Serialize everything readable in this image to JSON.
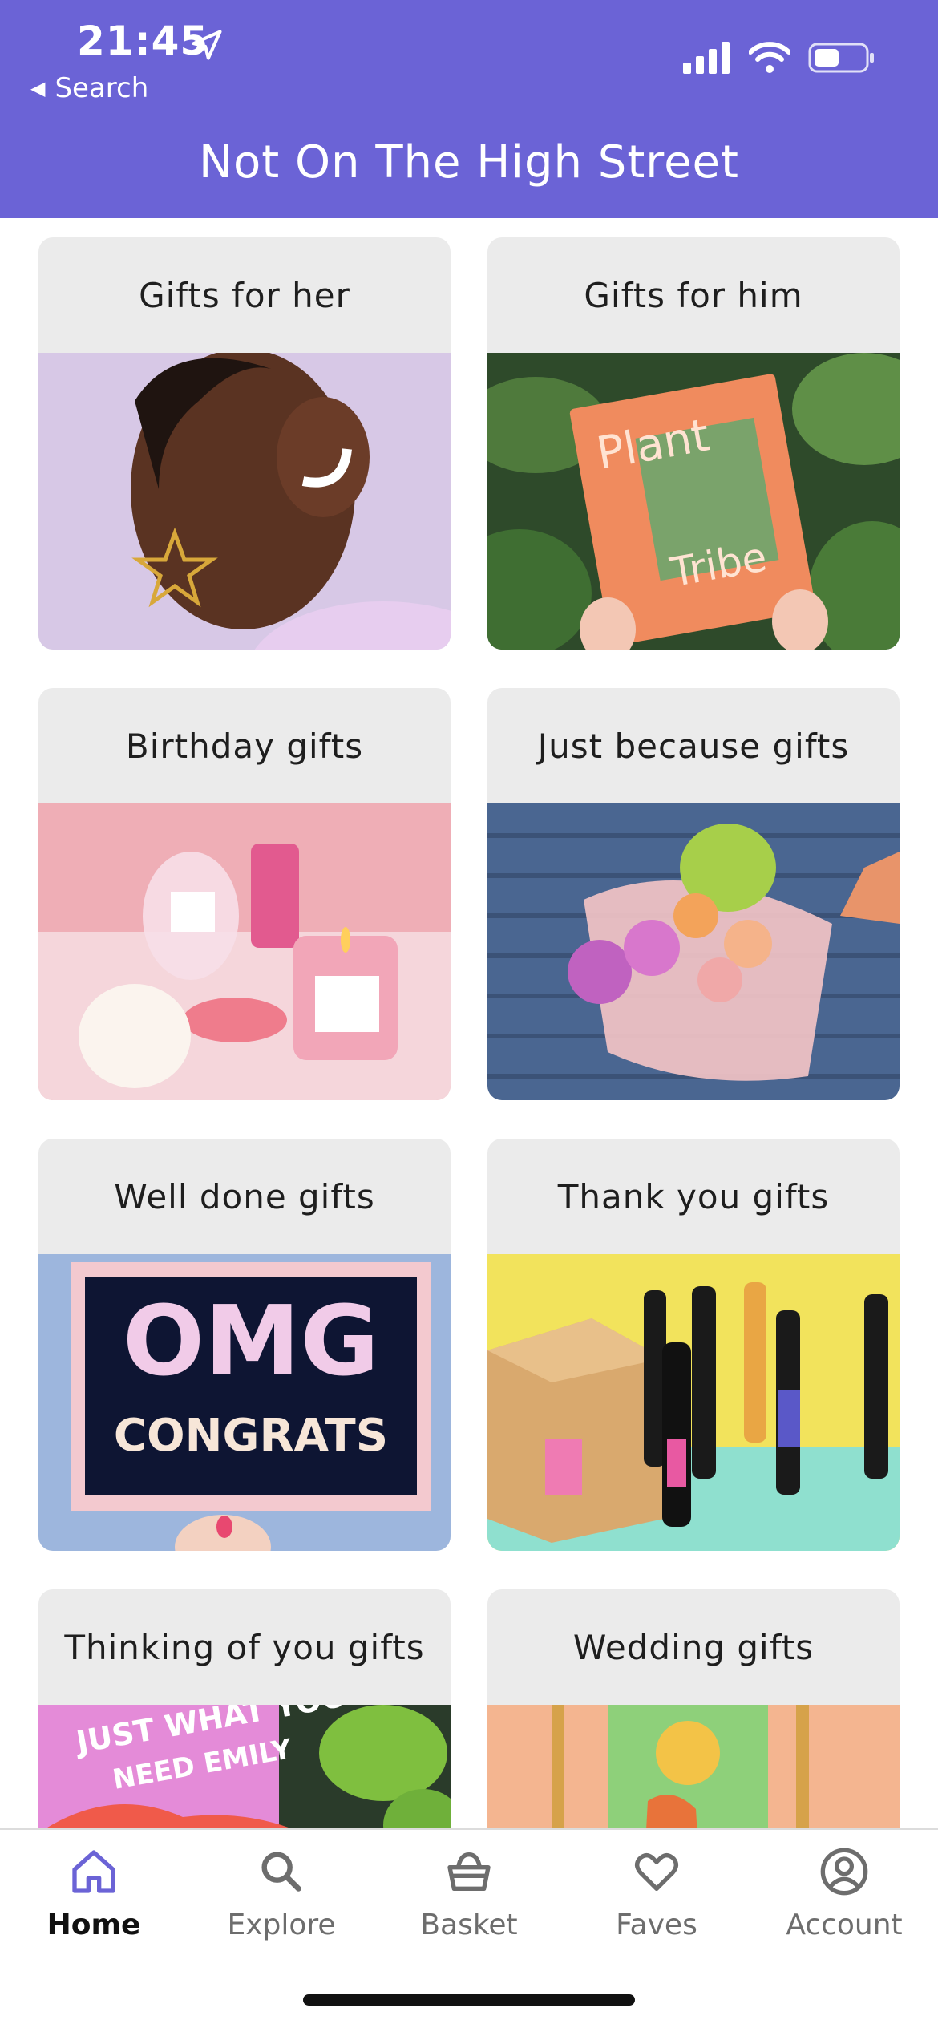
{
  "status_bar": {
    "time": "21:45",
    "back_label": "Search"
  },
  "header": {
    "title": "Not On The High Street",
    "background": "#6b63d6"
  },
  "categories": [
    {
      "label": "Gifts for her"
    },
    {
      "label": "Gifts for him"
    },
    {
      "label": "Birthday gifts"
    },
    {
      "label": "Just because gifts"
    },
    {
      "label": "Well done gifts",
      "image_text_1": "OMG",
      "image_text_2": "CONGRATS"
    },
    {
      "label": "Thank you gifts"
    },
    {
      "label": "Thinking of you gifts",
      "image_text_1": "JUST WHAT YOU",
      "image_text_2": "NEED EMILY"
    },
    {
      "label": "Wedding gifts"
    }
  ],
  "tabs": [
    {
      "label": "Home",
      "icon": "home-icon",
      "active": true
    },
    {
      "label": "Explore",
      "icon": "search-icon"
    },
    {
      "label": "Basket",
      "icon": "basket-icon"
    },
    {
      "label": "Faves",
      "icon": "heart-icon"
    },
    {
      "label": "Account",
      "icon": "account-icon"
    }
  ],
  "colors": {
    "accent": "#6b63d6",
    "card_label_bg": "#ebebeb"
  }
}
